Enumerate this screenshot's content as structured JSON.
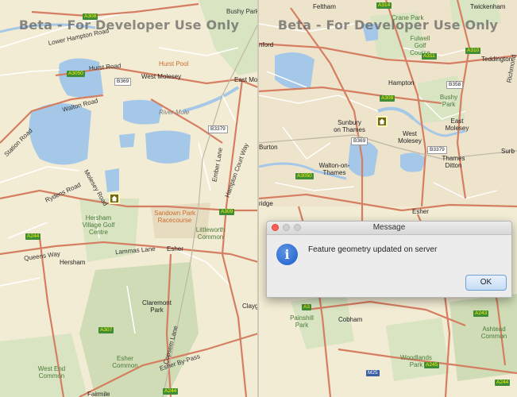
{
  "watermark": "Beta - For Developer Use Only",
  "colors": {
    "land": "#f2ecd4",
    "water": "#a6c8e8",
    "park": "#d8e4c2",
    "road_major": "#d57e62",
    "road_minor": "#ffffff",
    "marker": "#6e6a12"
  },
  "left_map": {
    "places": {
      "bushy_park": "Bushy Park",
      "west_molesey": "West Molesey",
      "east_molesey": "East Molesey",
      "hurst_pool": "Hurst Pool",
      "hersham_golf": "Hersham Village Golf Centre",
      "sandown_park": "Sandown Park Racecourse",
      "littleworth_common": "Littleworth Common",
      "hersham": "Hersham",
      "esher": "Esher",
      "claremont_park": "Claremont Park",
      "esher_common": "Esher Common",
      "west_end_common": "West End Common",
      "fairmile": "Fairmile",
      "claygate": "Clayg",
      "river_mole": "River Mole"
    },
    "roads": {
      "hurst_road": "Hurst Road",
      "lower_hampton_road": "Lower Hampton Road",
      "walton_road": "Walton Road",
      "molesey_road": "Molesey Road",
      "rydens_road": "Rydens Road",
      "hampton_court_way": "Hampton Court Way",
      "queens_way": "Queens Way",
      "lammas_lane": "Lammas Lane",
      "esher_by_pass": "Esher By-Pass",
      "copsem_lane": "Copsem Lane",
      "ember_lane": "Ember Lane",
      "station_road": "Station Road"
    },
    "shields": {
      "a308": "A308",
      "a3050": "A3050",
      "b369": "B369",
      "b3379": "B3379",
      "a309": "A309",
      "a244": "A244",
      "a307": "A307",
      "a244b": "A244"
    }
  },
  "right_map": {
    "places": {
      "feltham": "Feltham",
      "twickenham": "Twickenham",
      "crane_park": "Crane Park",
      "fulwell_golf": "Fulwell Golf Course",
      "teddington": "Teddington",
      "hampton": "Hampton",
      "bushy_park": "Bushy Park",
      "east_molesey": "East Molesey",
      "sunbury": "Sunbury on Thames",
      "west_molesey": "West Molesey",
      "thames_ditton": "Thames Ditton",
      "walton": "Walton-on-Thames",
      "esher": "Esher",
      "cobham": "Cobham",
      "painshill_park": "Painshill Park",
      "woodlands_park": "Woodlands Park",
      "ashtead_common": "Ashtead Common",
      "burton": "Burton",
      "ridge": "ridge",
      "nford": "nford",
      "surb": "Surb",
      "richmond": "Richmond"
    },
    "shields": {
      "a314": "A314",
      "a311": "A311",
      "a310": "A310",
      "a308": "A308",
      "b358": "B358",
      "b369": "B369",
      "b3379": "B3379",
      "a3050": "A3050",
      "a3": "A3",
      "a243": "A243",
      "a245": "A245",
      "m25": "M25",
      "a244": "A244"
    }
  },
  "dialog": {
    "title": "Message",
    "message": "Feature geometry updated on server",
    "ok_label": "OK"
  }
}
